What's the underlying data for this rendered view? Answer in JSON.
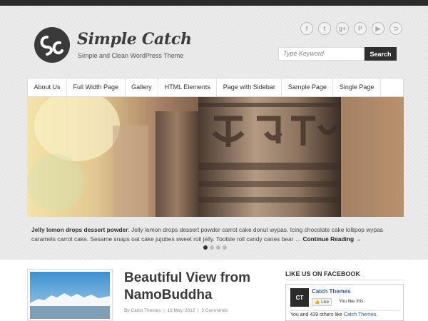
{
  "site": {
    "title": "Simple Catch",
    "tagline": "Simple and Clean WordPress Theme"
  },
  "social": [
    {
      "icon": "facebook-icon",
      "glyph": "f"
    },
    {
      "icon": "twitter-icon",
      "glyph": "t"
    },
    {
      "icon": "googleplus-icon",
      "glyph": "g+"
    },
    {
      "icon": "pinterest-icon",
      "glyph": "P"
    },
    {
      "icon": "youtube-icon",
      "glyph": "▶"
    },
    {
      "icon": "rss-icon",
      "glyph": "⊃"
    }
  ],
  "search": {
    "placeholder": "Type Keyword",
    "button_label": "Search"
  },
  "nav": {
    "items": [
      "About Us",
      "Full Width Page",
      "Gallery",
      "HTML Elements",
      "Page with Sidebar",
      "Sample Page",
      "Single Page"
    ]
  },
  "slider": {
    "caption_title": "Jelly lemon drops dessert powder",
    "caption_text": ": Jelly lemon drops dessert powder carrot cake donut wypas. Icing chocolate cake lollipop wypas caramels carrot cake. Sesame snaps oat cake jujubes sweet roll jelly. Tootsie roll candy canes bear … ",
    "continue_label": "Continue Reading →",
    "active_slide": 1,
    "slide_count": 4
  },
  "post": {
    "title": "Beautiful View from NamoBuddha",
    "author": "By Catch Themes",
    "date": "16 May, 2012",
    "comments": "3 Comments",
    "sep1": "|",
    "sep2": "|"
  },
  "sidebar": {
    "fb_heading": "LIKE US ON FACEBOOK",
    "fb_logo_text": "CT",
    "fb_name": "Catch Themes",
    "fb_like_label": "👍 Like",
    "fb_you_like": "You like this.",
    "fb_count_prefix": "You and 439 others like ",
    "fb_count_link": "Catch Themes."
  },
  "colors": {
    "accent": "#2f2f2f",
    "background": "#e9e9e9",
    "facebook": "#3b5998"
  }
}
